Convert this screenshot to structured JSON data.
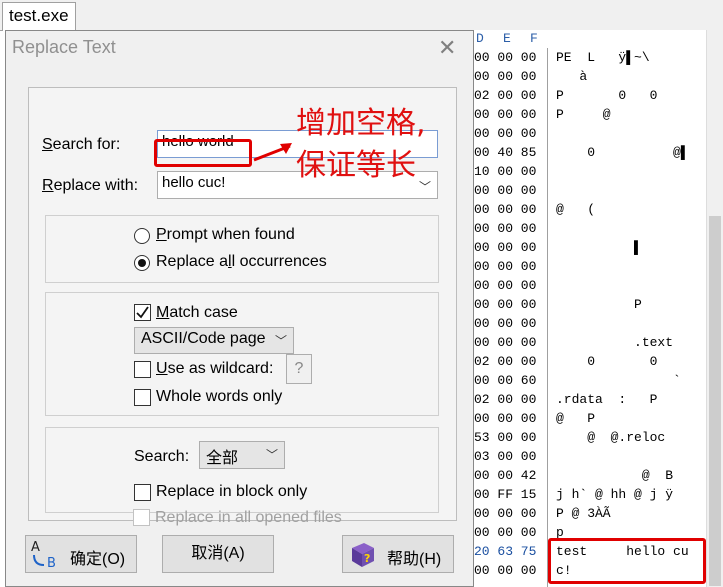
{
  "tab": {
    "title": "test.exe"
  },
  "hex": {
    "column_headers": [
      "D",
      "E",
      "F"
    ],
    "rows": [
      {
        "hex": "00 00 00",
        "text": "PE  L   ÿ▌~\\"
      },
      {
        "hex": "00 00 00",
        "text": "   à"
      },
      {
        "hex": "02 00 00",
        "text": "P       0   0"
      },
      {
        "hex": "00 00 00",
        "text": "P     @"
      },
      {
        "hex": "00 00 00",
        "text": ""
      },
      {
        "hex": "00 40 85",
        "text": "    0          @▌"
      },
      {
        "hex": "10 00 00",
        "text": ""
      },
      {
        "hex": "00 00 00",
        "text": ""
      },
      {
        "hex": "00 00 00",
        "text": "@   ("
      },
      {
        "hex": "00 00 00",
        "text": ""
      },
      {
        "hex": "00 00 00",
        "text": "          ▌"
      },
      {
        "hex": "00 00 00",
        "text": ""
      },
      {
        "hex": "00 00 00",
        "text": ""
      },
      {
        "hex": "00 00 00",
        "text": "          P"
      },
      {
        "hex": "00 00 00",
        "text": ""
      },
      {
        "hex": "00 00 00",
        "text": "          .text"
      },
      {
        "hex": "02 00 00",
        "text": "    0       0"
      },
      {
        "hex": "00 00 60",
        "text": "               `"
      },
      {
        "hex": "02 00 00",
        "text": ".rdata  :   P"
      },
      {
        "hex": "00 00 00",
        "text": "@   P"
      },
      {
        "hex": "53 00 00",
        "text": "    @  @.reloc"
      },
      {
        "hex": "03 00 00",
        "text": ""
      },
      {
        "hex": "00 00 42",
        "text": "           @  B"
      },
      {
        "hex": "00 FF 15",
        "text": "j h` @ hh @ j ÿ"
      },
      {
        "hex": "00 00 00",
        "text": "P @ 3ÀÃ"
      },
      {
        "hex": "00 00 00",
        "text": "p"
      },
      {
        "hex": "20 63 75",
        "text": "test     hello cu"
      },
      {
        "hex": "00 00 00",
        "text": "c!"
      }
    ]
  },
  "dialog": {
    "title": "Replace Text",
    "close_label": "✕",
    "search_for_label_u": "S",
    "search_for_label": "earch for:",
    "search_value": "hello world",
    "replace_with_label_u": "R",
    "replace_with_label": "eplace with:",
    "replace_value": "hello cuc!",
    "prompt_label_u": "P",
    "prompt_label": "rompt when found",
    "replace_all_label_a": "Replace a",
    "replace_all_label_u": "l",
    "replace_all_label_b": "l occurrences",
    "match_case_label_u": "M",
    "match_case_label": "atch case",
    "encoding_value": "ASCII/Code page",
    "wildcard_label_u": "U",
    "wildcard_label": "se as wildcard:",
    "wildcard_help": "?",
    "whole_words_label": "Whole words only",
    "search_scope_label": "Search:",
    "search_scope_value": "全部",
    "block_only_label": "Replace in block only",
    "all_files_label": "Replace in all opened files",
    "ok_label": "确定(O)",
    "cancel_label": "取消(A)",
    "help_label": "帮助(H)"
  },
  "annotation": {
    "line1": "增加空格,",
    "line2": "保证等长"
  },
  "colors": {
    "annotation_red": "#e00000",
    "hex_offset_blue": "#1a4fa0"
  }
}
